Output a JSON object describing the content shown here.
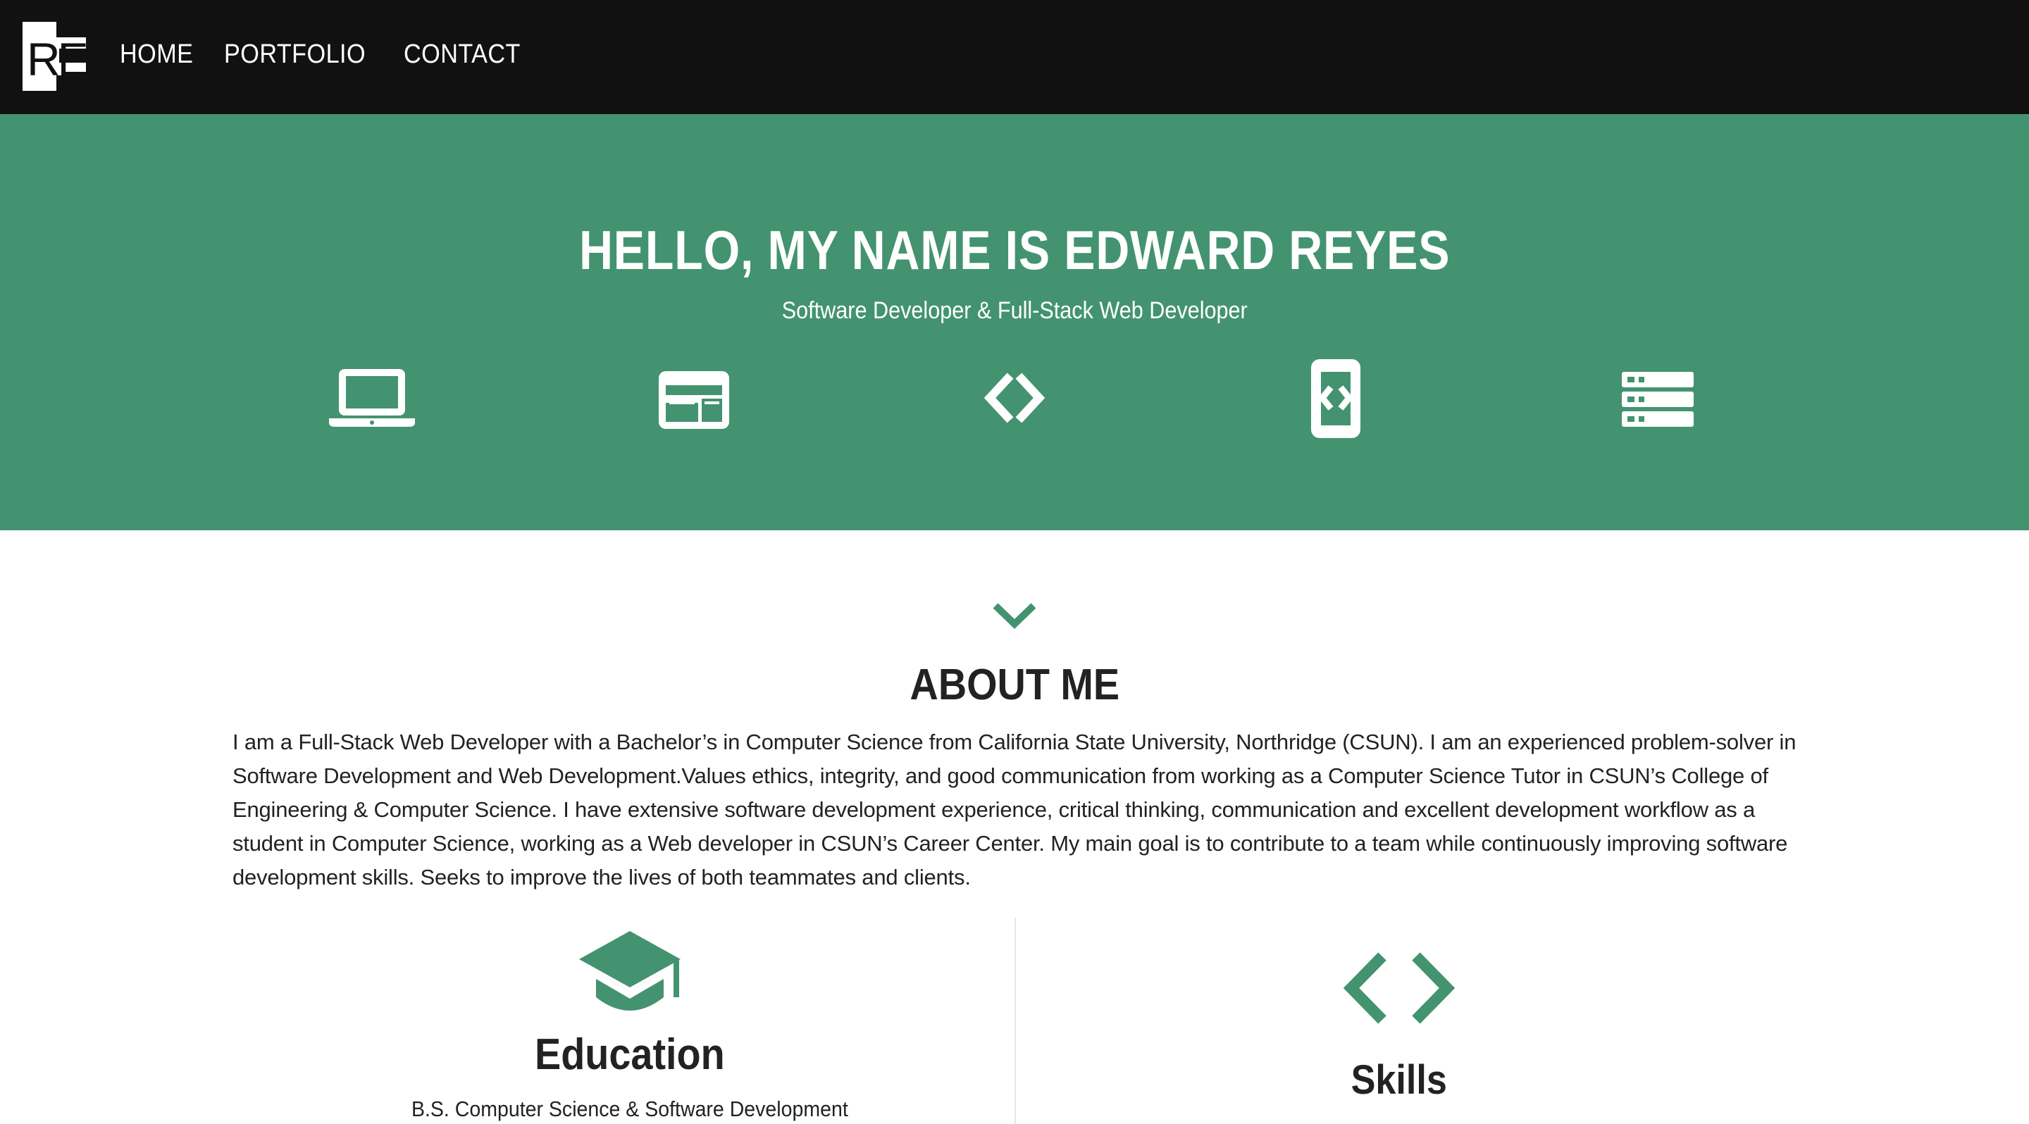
{
  "brand": {
    "logo_text": "RE"
  },
  "nav": {
    "items": [
      {
        "label": "HOME"
      },
      {
        "label": "PORTFOLIO"
      },
      {
        "label": "CONTACT"
      }
    ]
  },
  "hero": {
    "title": "HELLO, MY NAME IS EDWARD REYES",
    "subtitle": "Software Developer & Full-Stack Web Developer",
    "icons": [
      "laptop-icon",
      "browser-window-icon",
      "code-icon",
      "mobile-code-icon",
      "server-list-icon"
    ],
    "background_color": "#439370"
  },
  "about": {
    "title": "ABOUT ME",
    "text": "I am a Full-Stack Web Developer with a Bachelor’s in Computer Science from California State University, Northridge (CSUN). I am an experienced problem-solver in Software Development and Web Development.Values ethics, integrity, and good communication from working as a Computer Science Tutor in CSUN’s College of Engineering & Computer Science. I have extensive software development experience, critical thinking, communication and excellent development workflow as a student in Computer Science, working as a Web developer in CSUN’s Career Center. My main goal is to contribute to a team while continuously improving software development skills. Seeks to improve the lives of both teammates and clients."
  },
  "education": {
    "title": "Education",
    "degree": "B.S. Computer Science & Software Development",
    "icon": "graduation-cap-icon"
  },
  "skills": {
    "title": "Skills",
    "icon": "code-icon"
  },
  "colors": {
    "accent": "#439370",
    "navbar": "#111111",
    "text": "#222222"
  }
}
